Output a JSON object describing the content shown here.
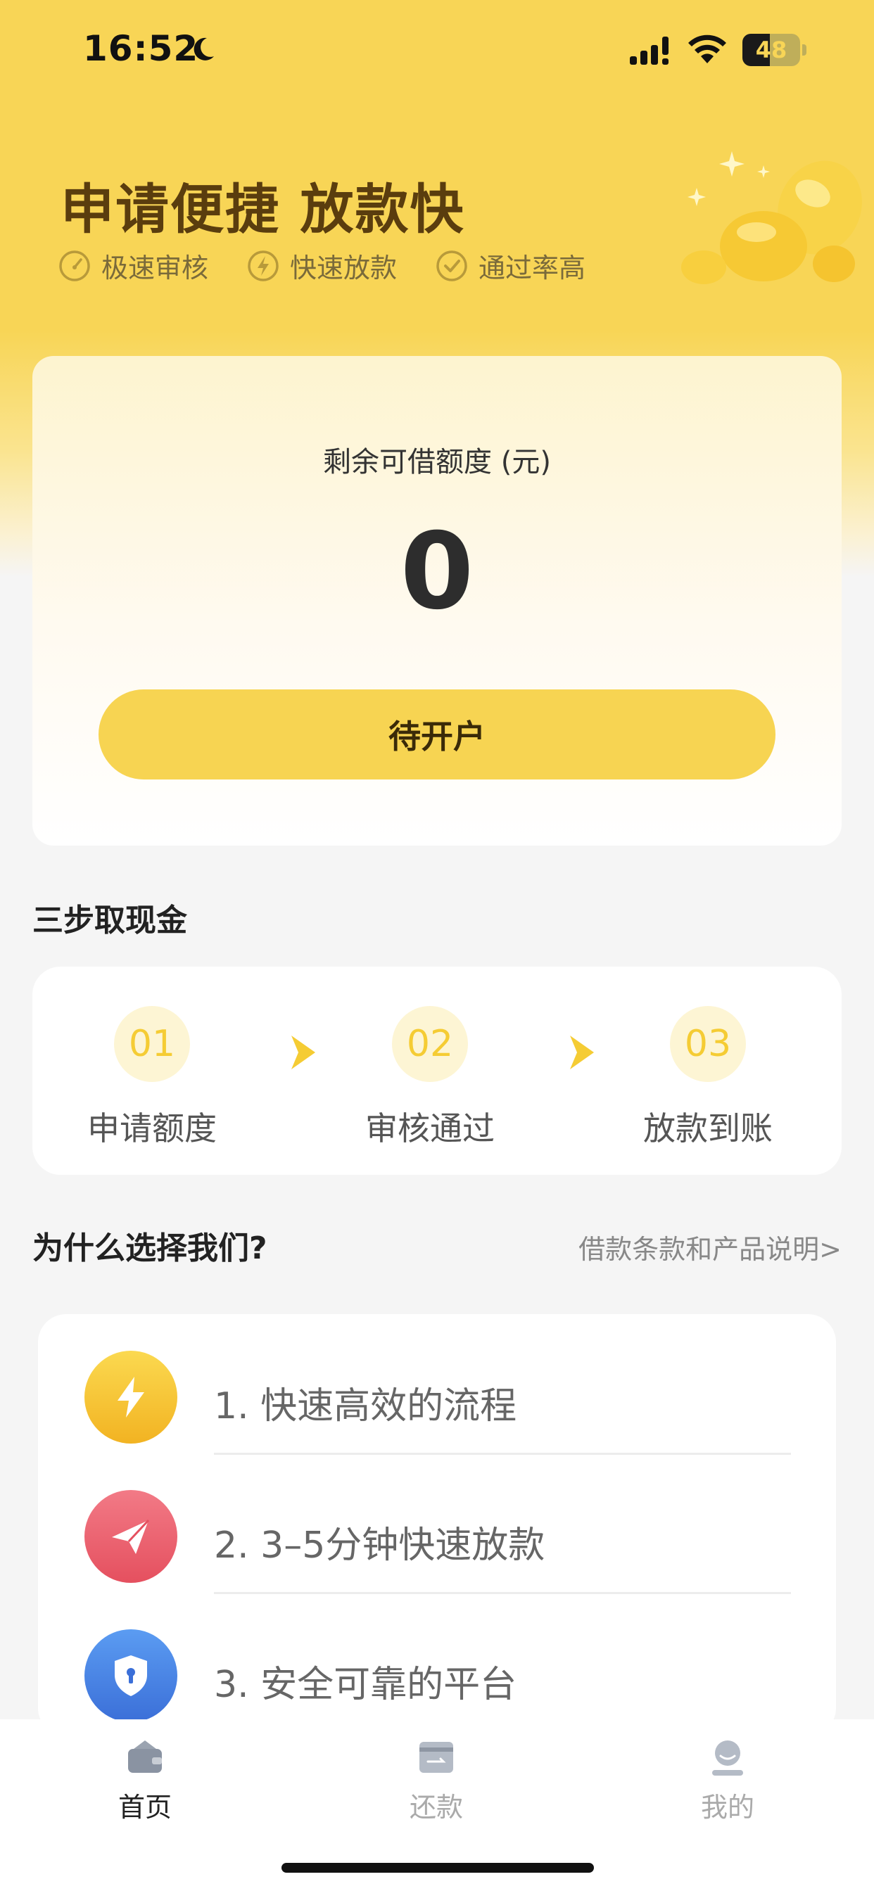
{
  "status_bar": {
    "time": "16:52",
    "battery": "48",
    "battery_level": 0.48
  },
  "hero": {
    "title": "申请便捷 放款快",
    "features": [
      "极速审核",
      "快速放款",
      "通过率高"
    ]
  },
  "credit": {
    "label": "剩余可借额度 (元)",
    "amount": "0",
    "button_label": "待开户"
  },
  "steps": {
    "title": "三步取现金",
    "items": [
      {
        "num": "01",
        "label": "申请额度"
      },
      {
        "num": "02",
        "label": "审核通过"
      },
      {
        "num": "03",
        "label": "放款到账"
      }
    ]
  },
  "why": {
    "title": "为什么选择我们?",
    "link": "借款条款和产品说明>",
    "items": [
      {
        "text": "1. 快速高效的流程",
        "icon": "lightning-icon",
        "color": "#f5c12c"
      },
      {
        "text": "2. 3–5分钟快速放款",
        "icon": "paper-plane-icon",
        "color": "#ec5f6f"
      },
      {
        "text": "3. 安全可靠的平台",
        "icon": "shield-icon",
        "color": "#4a86e8"
      }
    ]
  },
  "tabs": [
    {
      "label": "首页",
      "icon": "wallet-icon",
      "active": true
    },
    {
      "label": "还款",
      "icon": "card-icon",
      "active": false
    },
    {
      "label": "我的",
      "icon": "user-icon",
      "active": false
    }
  ],
  "colors": {
    "accent": "#f7d452",
    "title": "#5a3d0e"
  }
}
